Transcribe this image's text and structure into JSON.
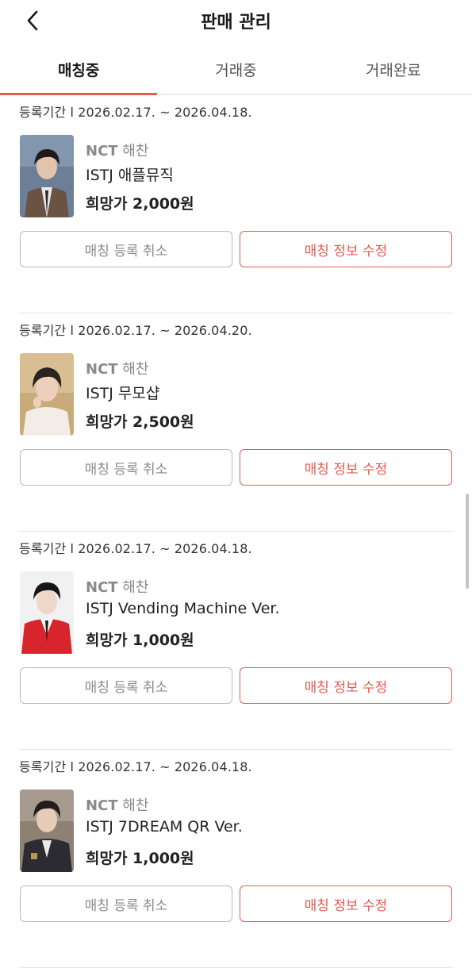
{
  "header": {
    "title": "판매 관리"
  },
  "tabs": [
    {
      "label": "매칭중",
      "active": true
    },
    {
      "label": "거래중",
      "active": false
    },
    {
      "label": "거래완료",
      "active": false
    }
  ],
  "listings": [
    {
      "period": "등록기간 l 2026.02.17. ~ 2026.04.18.",
      "group": "NCT",
      "member": "해찬",
      "title": "ISTJ 애플뮤직",
      "price": "희망가 2,000원",
      "cancel_label": "매칭 등록 취소",
      "edit_label": "매칭 정보 수정"
    },
    {
      "period": "등록기간 l 2026.02.17. ~ 2026.04.20.",
      "group": "NCT",
      "member": "해찬",
      "title": "ISTJ 무모샵",
      "price": "희망가 2,500원",
      "cancel_label": "매칭 등록 취소",
      "edit_label": "매칭 정보 수정"
    },
    {
      "period": "등록기간 l 2026.02.17. ~ 2026.04.18.",
      "group": "NCT",
      "member": "해찬",
      "title": "ISTJ Vending Machine Ver.",
      "price": "희망가 1,000원",
      "cancel_label": "매칭 등록 취소",
      "edit_label": "매칭 정보 수정"
    },
    {
      "period": "등록기간 l 2026.02.17. ~ 2026.04.18.",
      "group": "NCT",
      "member": "해찬",
      "title": "ISTJ 7DREAM QR Ver.",
      "price": "희망가 1,000원",
      "cancel_label": "매칭 등록 취소",
      "edit_label": "매칭 정보 수정"
    }
  ],
  "icons": {
    "back": "chevron-left-icon"
  },
  "colors": {
    "accent": "#e85a4f",
    "muted": "#8a8a8a",
    "border": "#b9b9b9"
  }
}
